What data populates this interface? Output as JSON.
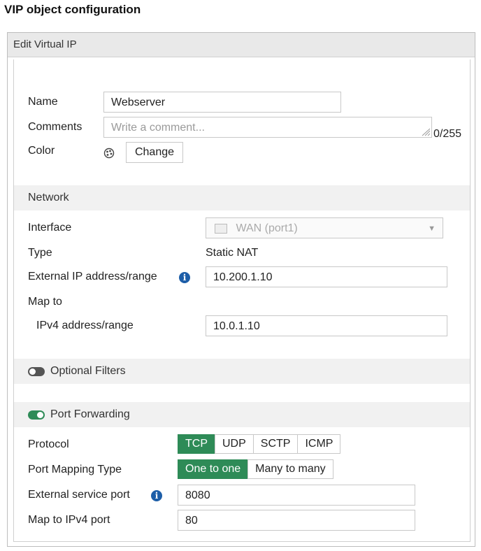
{
  "caption": "VIP object configuration",
  "panel": {
    "title": "Edit Virtual IP"
  },
  "form": {
    "name_label": "Name",
    "name_value": "Webserver",
    "comments_label": "Comments",
    "comments_placeholder": "Write a comment...",
    "comments_counter": "0/255",
    "color_label": "Color",
    "color_button": "Change"
  },
  "network": {
    "title": "Network",
    "interface_label": "Interface",
    "interface_value": "WAN (port1)",
    "type_label": "Type",
    "type_value": "Static NAT",
    "ext_ip_label": "External IP address/range",
    "ext_ip_value": "10.200.1.10",
    "map_to_label": "Map to",
    "ipv4_label": "IPv4 address/range",
    "ipv4_value": "10.0.1.10"
  },
  "optional_filters": {
    "label": "Optional Filters",
    "enabled": false
  },
  "port_forwarding": {
    "label": "Port Forwarding",
    "enabled": true,
    "protocol_label": "Protocol",
    "protocols": [
      "TCP",
      "UDP",
      "SCTP",
      "ICMP"
    ],
    "protocol_selected": "TCP",
    "mapping_label": "Port Mapping Type",
    "mapping_options": [
      "One to one",
      "Many to many"
    ],
    "mapping_selected": "One to one",
    "ext_port_label": "External service port",
    "ext_port_value": "8080",
    "map_port_label": "Map to IPv4 port",
    "map_port_value": "80"
  },
  "colors": {
    "accent": "#2e8b57",
    "info": "#1d5ea8"
  },
  "icons": {
    "color": "palette-icon",
    "resize": "resize-grip-icon",
    "interface": "network-port-icon",
    "dropdown": "chevron-down-icon",
    "info": "info-icon"
  }
}
